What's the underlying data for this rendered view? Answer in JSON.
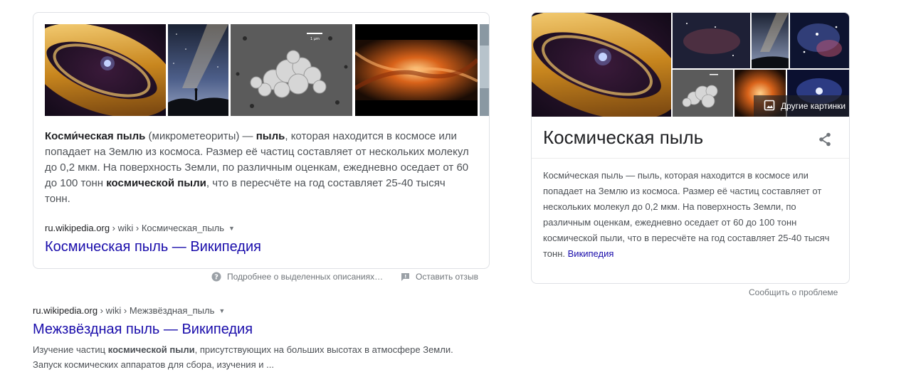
{
  "featured_snippet": {
    "text": {
      "t1": "Косми́ческая пыль",
      "t2": " (микрометеориты) — ",
      "t3": "пыль",
      "t4": ", которая находится в космосе или попадает на Землю из космоса. Размер её частиц составляет от нескольких молекул до 0,2 мкм. На поверхность Земли, по различным оценкам, ежедневно оседает от 60 до 100 тонн ",
      "t5": "космической пыли",
      "t6": ", что в пересчёте на год составляет 25-40 тысяч тонн."
    },
    "cite_domain": "ru.wikipedia.org",
    "cite_path": " › wiki › Космическая_пыль",
    "link_title": "Космическая пыль — Википедия",
    "images": [
      "dust-disk-image",
      "milky-way-silhouette-image",
      "microscope-dust-particle-image",
      "orange-nebula-image",
      "partial-image"
    ],
    "scale_label": "1 µm"
  },
  "feedback": {
    "about_snippets": "Подробнее о выделенных описаниях…",
    "leave_feedback": "Оставить отзыв"
  },
  "result2": {
    "cite_domain": "ru.wikipedia.org",
    "cite_path": " › wiki › Межзвёздная_пыль",
    "link_title": "Межзвёздная пыль — Википедия",
    "desc": {
      "d1": "Изучение частиц ",
      "d2": "космической пыли",
      "d3": ", присутствующих на больших высотах в атмосфере Земли. Запуск космических аппаратов для сбора, изучения и ..."
    }
  },
  "knowledge_panel": {
    "title": "Космическая пыль",
    "more_images": "Другие картинки",
    "description": "Косми́ческая пыль — пыль, которая находится в космосе или попадает на Землю из космоса. Размер её частиц составляет от нескольких молекул до 0,2 мкм. На поверхность Земли, по различным оценкам, ежедневно оседает от 60 до 100 тонн космической пыли, что в пересчёте на год составляет 25-40 тысяч тонн.",
    "source_link": "Википедия",
    "report": "Сообщить о проблеме"
  },
  "colors": {
    "link": "#1a0dab",
    "text_secondary": "#4d5156",
    "muted": "#70757a",
    "border": "#dfe1e5"
  }
}
